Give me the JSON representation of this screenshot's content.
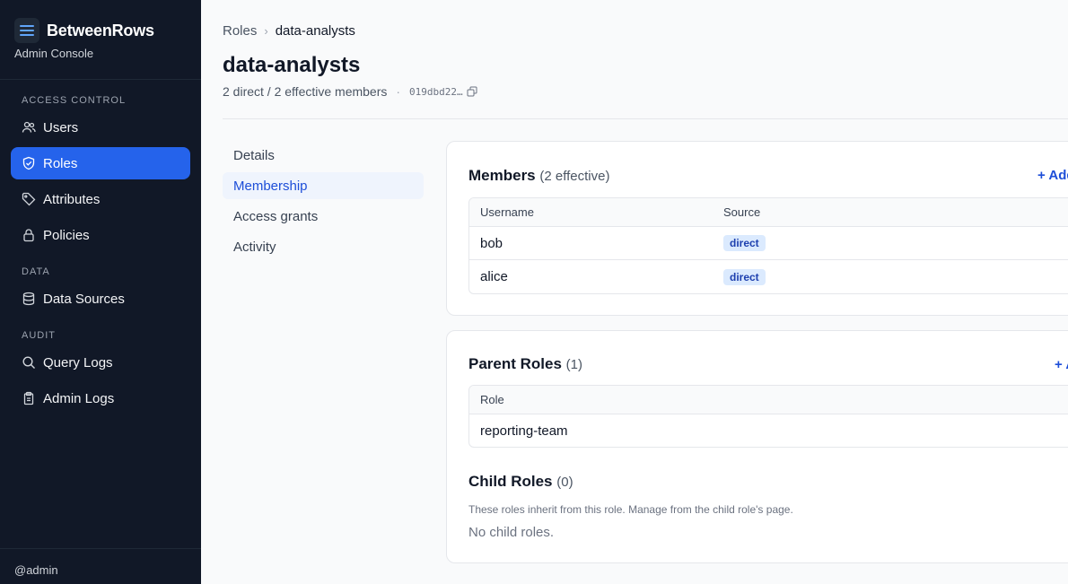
{
  "sidebar": {
    "brand": "BetweenRows",
    "subtitle": "Admin Console",
    "sections": {
      "access_control": "ACCESS CONTROL",
      "data": "DATA",
      "audit": "AUDIT"
    },
    "items": {
      "users": "Users",
      "roles": "Roles",
      "attributes": "Attributes",
      "policies": "Policies",
      "data_sources": "Data Sources",
      "query_logs": "Query Logs",
      "admin_logs": "Admin Logs"
    },
    "active": "roles",
    "user": "@admin"
  },
  "breadcrumb": {
    "parent": "Roles",
    "current": "data-analysts"
  },
  "page": {
    "title": "data-analysts",
    "subtitle": "2 direct / 2 effective members",
    "id": "019dbd22…"
  },
  "subnav": {
    "details": "Details",
    "membership": "Membership",
    "access_grants": "Access grants",
    "activity": "Activity",
    "active": "membership"
  },
  "members": {
    "title": "Members",
    "count": "(2 effective)",
    "add_label": "+ Add",
    "columns": [
      "Username",
      "Source"
    ],
    "rows": [
      {
        "username": "bob",
        "source": "direct"
      },
      {
        "username": "alice",
        "source": "direct"
      }
    ]
  },
  "parent_roles": {
    "title": "Parent Roles",
    "count": "(1)",
    "add_label": "+ Add",
    "columns": [
      "Role"
    ],
    "rows": [
      {
        "role": "reporting-team"
      }
    ]
  },
  "child_roles": {
    "title": "Child Roles",
    "count": "(0)",
    "help": "These roles inherit from this role. Manage from the child role's page.",
    "empty": "No child roles."
  },
  "colors": {
    "sidebar_bg": "#111827",
    "accent": "#2563eb",
    "link": "#1d4ed8",
    "badge_bg": "#dbeafe"
  }
}
